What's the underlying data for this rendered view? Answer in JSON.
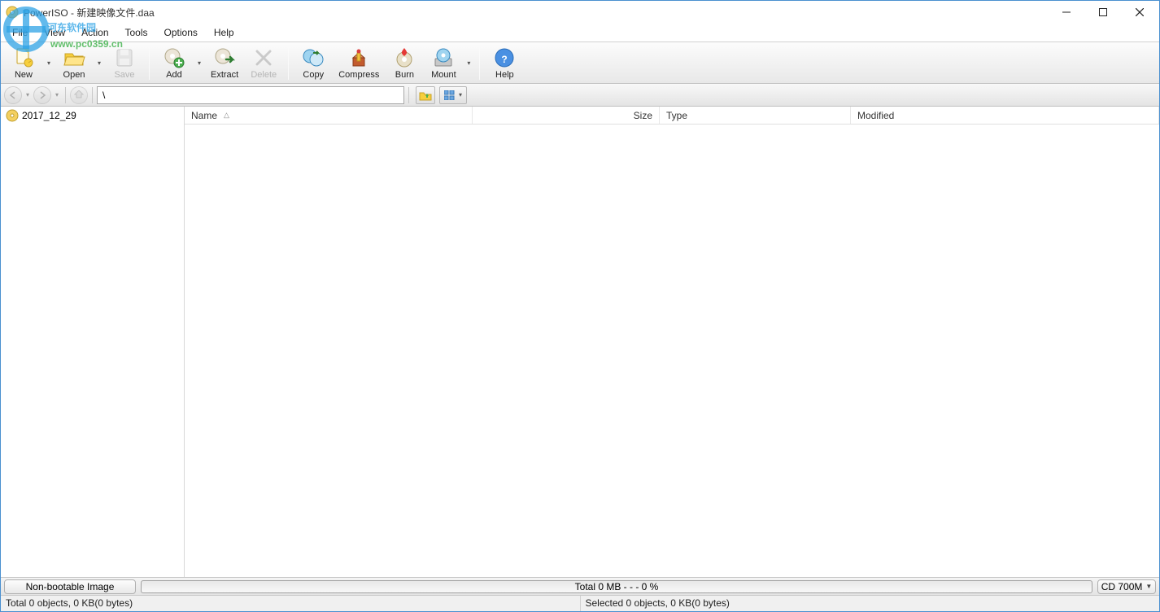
{
  "window": {
    "title": "PowerISO - 新建映像文件.daa"
  },
  "menu": {
    "file": "File",
    "view": "View",
    "action": "Action",
    "tools": "Tools",
    "options": "Options",
    "help": "Help"
  },
  "toolbar": {
    "new": "New",
    "open": "Open",
    "save": "Save",
    "add": "Add",
    "extract": "Extract",
    "delete": "Delete",
    "copy": "Copy",
    "compress": "Compress",
    "burn": "Burn",
    "mount": "Mount",
    "help": "Help"
  },
  "nav": {
    "path": "\\"
  },
  "tree": {
    "root": "2017_12_29"
  },
  "columns": {
    "name": "Name",
    "size": "Size",
    "type": "Type",
    "modified": "Modified"
  },
  "footer": {
    "boot_status": "Non-bootable Image",
    "progress_text": "Total  0 MB   - - -  0 %",
    "disc_size": "CD 700M"
  },
  "status": {
    "total": "Total 0 objects, 0 KB(0 bytes)",
    "selected": "Selected 0 objects, 0 KB(0 bytes)"
  },
  "watermark": {
    "brand": "河东软件园",
    "url": "www.pc0359.cn"
  }
}
